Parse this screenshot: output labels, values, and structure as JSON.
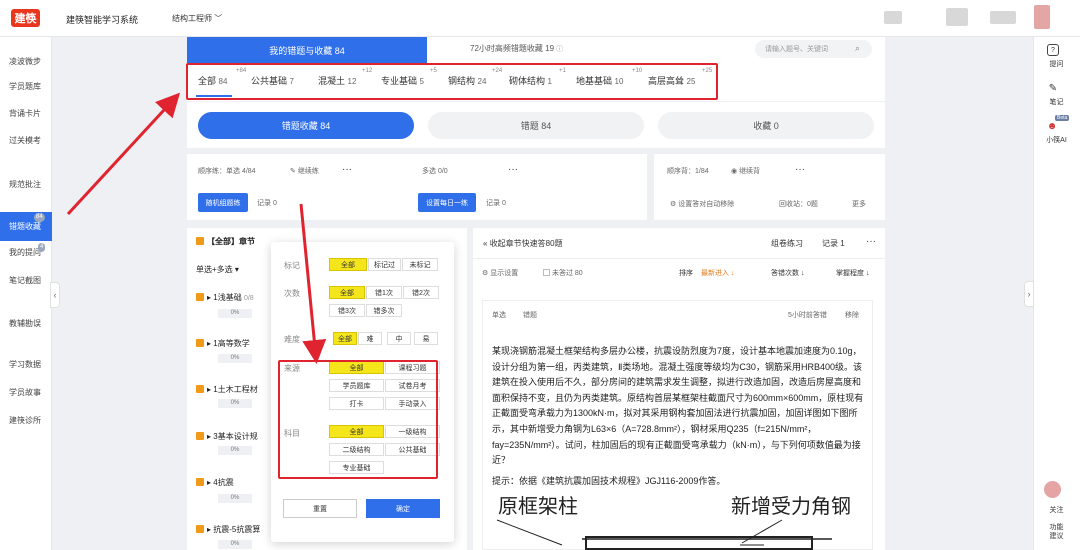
{
  "header": {
    "logo": "建筷",
    "app_title": "建筷智能学习系统",
    "exam_type": "结构工程师"
  },
  "sidebar": {
    "items": [
      "凌波微步",
      "学员题库",
      "背诵卡片",
      "过关模考",
      "规范批注",
      "错题收藏",
      "我的提问",
      "笔记截图",
      "教辅勘误",
      "学习数据",
      "学员故事",
      "建筷诊所"
    ],
    "badge_errors": "84",
    "badge_questions": "4"
  },
  "rightbar": {
    "ask": "提问",
    "notes": "笔记",
    "ai": "小筷AI",
    "beta": "Beta",
    "follow": "关注",
    "suggest": "功能\n建议"
  },
  "tabs": {
    "errors_fav": "我的错题与收藏 84",
    "high_freq": "72小时高频错题收藏 19",
    "search_placeholder": "请输入题号、关键词"
  },
  "subjects": [
    {
      "name": "全部",
      "count": "84",
      "sup": "+84"
    },
    {
      "name": "公共基础",
      "count": "7",
      "sup": ""
    },
    {
      "name": "混凝土",
      "count": "12",
      "sup": "+12"
    },
    {
      "name": "专业基础",
      "count": "5",
      "sup": "+5"
    },
    {
      "name": "钢结构",
      "count": "24",
      "sup": "+24"
    },
    {
      "name": "砌体结构",
      "count": "1",
      "sup": "+1"
    },
    {
      "name": "地基基础",
      "count": "10",
      "sup": "+10"
    },
    {
      "name": "高层高耸",
      "count": "25",
      "sup": "+25"
    }
  ],
  "filters": {
    "collect": "错题收藏 84",
    "wrong": "错题 84",
    "fav": "收藏 0"
  },
  "practice": {
    "order_label": "顺序练：",
    "single": "单选 4/84",
    "continue": "继续练",
    "multi": "多选 0/0",
    "random_group": "随机组题练",
    "record0": "记录 0",
    "daily": "设置每日一练",
    "record0b": "记录 0",
    "recite": "顺序背：1/84",
    "continue_recite": "继续背",
    "auto_remove": "设置答对自动移除",
    "recycle": "回收站：0题",
    "more": "更多"
  },
  "chapter_header": "【全部】章节",
  "select_mode": "单选+多选",
  "chapters": [
    {
      "name": "1浅基础",
      "score": "0/8",
      "pct": "0%"
    },
    {
      "name": "1高等数学",
      "score": "",
      "pct": "0%"
    },
    {
      "name": "1土木工程材",
      "score": "",
      "pct": "0%"
    },
    {
      "name": "3基本设计规",
      "score": "",
      "pct": "0%"
    },
    {
      "name": "4抗震",
      "score": "",
      "pct": "0%"
    },
    {
      "name": "抗震-5抗震算",
      "score": "",
      "pct": "0%"
    }
  ],
  "popup": {
    "mark_label": "标记",
    "mark_opts": [
      "全部",
      "标记过",
      "未标记"
    ],
    "times_label": "次数",
    "times_opts": [
      "全部",
      "错1次",
      "错2次",
      "错3次",
      "错多次"
    ],
    "diff_label": "难度",
    "diff_opts": [
      "全部",
      "难",
      "中",
      "易"
    ],
    "source_label": "来源",
    "source_opts": [
      "全部",
      "课程习题",
      "学员题库",
      "试卷月考",
      "打卡",
      "手动录入"
    ],
    "subject_label": "科目",
    "subject_opts": [
      "全部",
      "一级结构",
      "二级结构",
      "公共基础",
      "专业基础"
    ],
    "reset": "重置",
    "ok": "确定"
  },
  "question": {
    "back": "收起章节快速答80题",
    "group": "组卷练习",
    "record": "记录 1",
    "show_settings": "显示设置",
    "unanswered": "未答过 80",
    "sort": "排序",
    "newest": "最新进入",
    "answer_count": "答错次数",
    "mastery": "掌握程度",
    "type": "单选",
    "tag": "错题",
    "time": "5小时前答错",
    "remove": "移除",
    "body": "某现浇钢筋混凝土框架结构多层办公楼，抗震设防烈度为7度，设计基本地震加速度为0.10g，设计分组为第一组，丙类建筑，Ⅱ类场地。混凝土强度等级均为C30，钢筋采用HRB400级。该建筑在投入使用后不久，部分房间的建筑需求发生调整，拟进行改造加固，改造后房屋高度和面积保持不变，且仍为丙类建筑。原结构首层某框架柱截面尺寸为600mm×600mm，原柱现有正截面受弯承载力为1300kN·m，拟对其采用钢构套加固法进行抗震加固，加固详图如下图所示，其中新增受力角钢为L63×6（A=728.8mm²），钢材采用Q235（f=215N/mm²，fay=235N/mm²）。试问，柱加固后的现有正截面受弯承载力（kN·m），与下列何项数值最为接近？",
    "hint": "提示：依据《建筑抗震加固技术规程》JGJ116-2009作答。",
    "fig_left": "原框架柱",
    "fig_right": "新增受力角钢"
  },
  "colors": {
    "accent": "#2f6fea",
    "highlight": "#f5e51b",
    "annotation": "#e0242f",
    "checkbox": "#f19a1a"
  }
}
